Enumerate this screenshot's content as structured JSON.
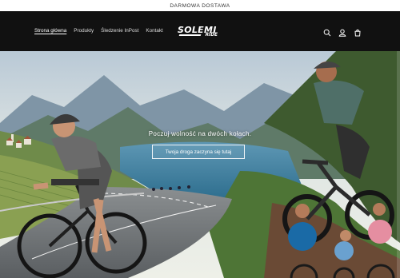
{
  "announcement": "DARMOWA DOSTAWA",
  "header": {
    "nav": [
      {
        "label": "Strona główna",
        "active": true
      },
      {
        "label": "Produkty"
      },
      {
        "label": "Śledzenie InPost"
      },
      {
        "label": "Kontakt"
      }
    ],
    "logo_top": "SOLEMI",
    "logo_bottom": "RIDE",
    "icons": [
      "search-icon",
      "account-icon",
      "cart-icon"
    ]
  },
  "hero": {
    "heading": "Poczuj wolność na dwóch kołach.",
    "button_label": "Twoja droga zaczyna się tutaj"
  },
  "colors": {
    "header_bg": "#111111",
    "text_light": "#ffffff"
  }
}
